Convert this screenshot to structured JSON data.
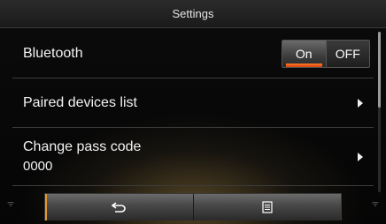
{
  "header": {
    "title": "Settings"
  },
  "rows": {
    "bluetooth": {
      "label": "Bluetooth",
      "toggle": {
        "on_label": "On",
        "off_label": "OFF",
        "selected": "On"
      }
    },
    "paired": {
      "label": "Paired devices list"
    },
    "passcode": {
      "label": "Change pass code",
      "value": "0000"
    }
  },
  "bottom_bar": {
    "back_icon": "back-arrow-icon",
    "menu_icon": "menu-list-icon"
  },
  "corner_icons": {
    "left": "ᯤ",
    "right": "ᯤ"
  },
  "colors": {
    "accent": "#e36a1f"
  }
}
